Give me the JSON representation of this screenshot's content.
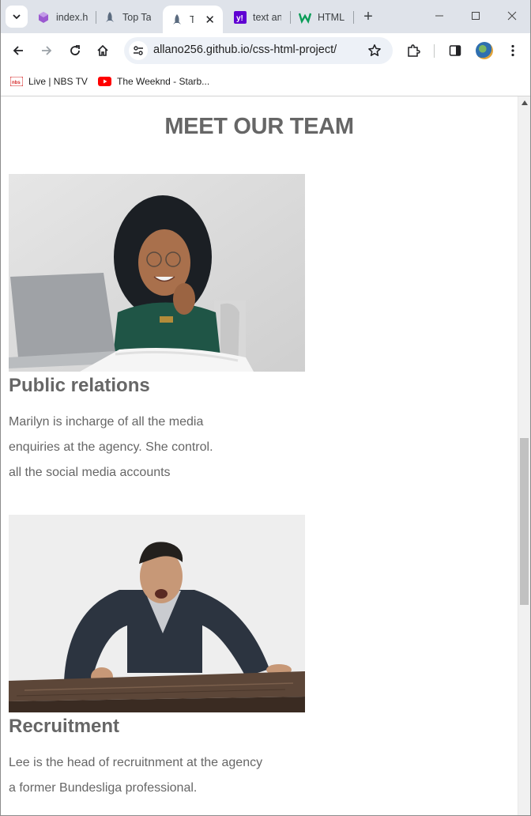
{
  "browser": {
    "tabs": [
      {
        "title": "index.h",
        "icon": "cube-icon",
        "active": false
      },
      {
        "title": "Top Ta",
        "icon": "rocket-icon",
        "active": false
      },
      {
        "title": "To",
        "icon": "rocket-icon",
        "active": true
      },
      {
        "title": "text an",
        "icon": "yahoo-icon",
        "active": false
      },
      {
        "title": "HTML",
        "icon": "w-logo-icon",
        "active": false
      }
    ],
    "new_tab_label": "+",
    "url": "allano256.github.io/css-html-project/",
    "bookmarks": [
      {
        "label": "Live | NBS TV",
        "icon": "nbs-icon"
      },
      {
        "label": "The Weeknd - Starb...",
        "icon": "youtube-icon"
      }
    ]
  },
  "page": {
    "heading": "MEET OUR TEAM",
    "members": [
      {
        "role": "Public relations",
        "photo_alt": "Woman with curly hair smiling at laptop",
        "description_lines": [
          "Marilyn is incharge of all the media",
          "enquiries at the agency. She control.",
          "all the social media accounts"
        ]
      },
      {
        "role": "Recruitment",
        "photo_alt": "Man in suit shouting over wooden table",
        "description_lines": [
          "Lee is the head of recruitnment at the agency",
          "a former Bundesliga professional."
        ]
      }
    ]
  },
  "colors": {
    "tabstrip_bg": "#dfe3ea",
    "heading_text": "#666666",
    "omnibox_bg": "#edf1f7"
  }
}
